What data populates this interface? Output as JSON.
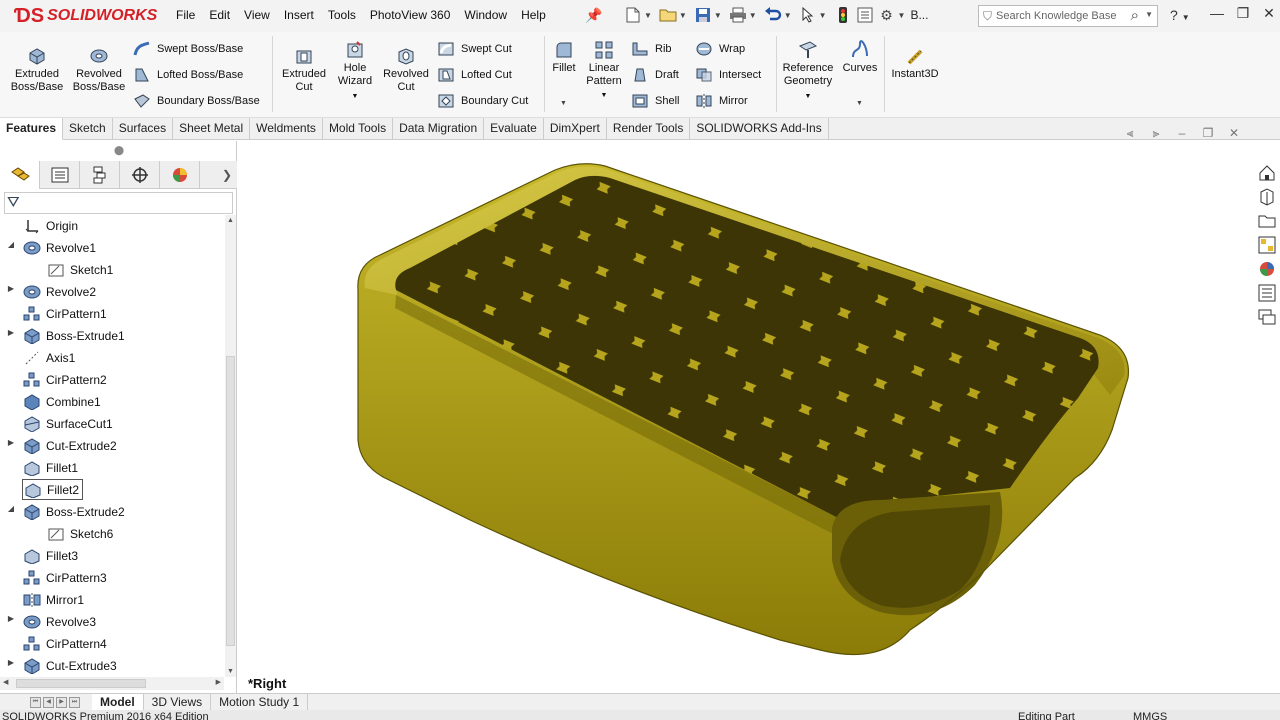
{
  "app": {
    "logo": "SOLIDWORKS",
    "menus": [
      "File",
      "Edit",
      "View",
      "Insert",
      "Tools",
      "PhotoView 360",
      "Window",
      "Help"
    ],
    "quick_access_overflow": "B...",
    "search_placeholder": "Search Knowledge Base",
    "help_label": "?"
  },
  "ribbon": {
    "extruded_boss": "Extruded Boss/Base",
    "revolved_boss": "Revolved Boss/Base",
    "swept_boss": "Swept Boss/Base",
    "lofted_boss": "Lofted Boss/Base",
    "boundary_boss": "Boundary Boss/Base",
    "extruded_cut": "Extruded Cut",
    "hole_wizard": "Hole Wizard",
    "revolved_cut": "Revolved Cut",
    "swept_cut": "Swept Cut",
    "lofted_cut": "Lofted Cut",
    "boundary_cut": "Boundary Cut",
    "fillet": "Fillet",
    "linear_pattern": "Linear Pattern",
    "rib": "Rib",
    "draft": "Draft",
    "shell": "Shell",
    "wrap": "Wrap",
    "intersect": "Intersect",
    "mirror": "Mirror",
    "reference_geometry": "Reference Geometry",
    "curves": "Curves",
    "instant3d": "Instant3D"
  },
  "tabs": [
    "Features",
    "Sketch",
    "Surfaces",
    "Sheet Metal",
    "Weldments",
    "Mold Tools",
    "Data Migration",
    "Evaluate",
    "DimXpert",
    "Render Tools",
    "SOLIDWORKS Add-Ins"
  ],
  "tree": [
    {
      "label": "Origin",
      "icon": "origin-icon",
      "expander": ""
    },
    {
      "label": "Revolve1",
      "icon": "revolve-feature-icon",
      "expander": "expanded"
    },
    {
      "label": "Sketch1",
      "icon": "sketch-icon",
      "expander": "",
      "child": true
    },
    {
      "label": "Revolve2",
      "icon": "revolve-feature-icon",
      "expander": "collapsed"
    },
    {
      "label": "CirPattern1",
      "icon": "circular-pattern-icon",
      "expander": ""
    },
    {
      "label": "Boss-Extrude1",
      "icon": "extrude-feature-icon",
      "expander": "collapsed"
    },
    {
      "label": "Axis1",
      "icon": "axis-icon",
      "expander": ""
    },
    {
      "label": "CirPattern2",
      "icon": "circular-pattern-icon",
      "expander": ""
    },
    {
      "label": "Combine1",
      "icon": "combine-icon",
      "expander": ""
    },
    {
      "label": "SurfaceCut1",
      "icon": "surface-cut-icon",
      "expander": ""
    },
    {
      "label": "Cut-Extrude2",
      "icon": "extrude-feature-icon",
      "expander": "collapsed"
    },
    {
      "label": "Fillet1",
      "icon": "fillet-icon",
      "expander": ""
    },
    {
      "label": "Fillet2",
      "icon": "fillet-icon",
      "expander": "",
      "selected": true
    },
    {
      "label": "Boss-Extrude2",
      "icon": "extrude-feature-icon",
      "expander": "expanded"
    },
    {
      "label": "Sketch6",
      "icon": "sketch-icon",
      "expander": "",
      "child": true
    },
    {
      "label": "Fillet3",
      "icon": "fillet-icon",
      "expander": ""
    },
    {
      "label": "CirPattern3",
      "icon": "circular-pattern-icon",
      "expander": ""
    },
    {
      "label": "Mirror1",
      "icon": "mirror-icon",
      "expander": ""
    },
    {
      "label": "Revolve3",
      "icon": "revolve-feature-icon",
      "expander": "collapsed"
    },
    {
      "label": "CirPattern4",
      "icon": "circular-pattern-icon",
      "expander": ""
    },
    {
      "label": "Cut-Extrude3",
      "icon": "extrude-feature-icon",
      "expander": "collapsed"
    }
  ],
  "viewport": {
    "view_label": "*Right",
    "model_color": "#a89a14"
  },
  "bottom_tabs": [
    "Model",
    "3D Views",
    "Motion Study 1"
  ],
  "status": {
    "left": "SOLIDWORKS Premium 2016 x64 Edition",
    "mode": "Editing Part",
    "units": "MMGS"
  },
  "colors": {
    "brand": "#d52027",
    "accent": "#2a6ad8"
  }
}
